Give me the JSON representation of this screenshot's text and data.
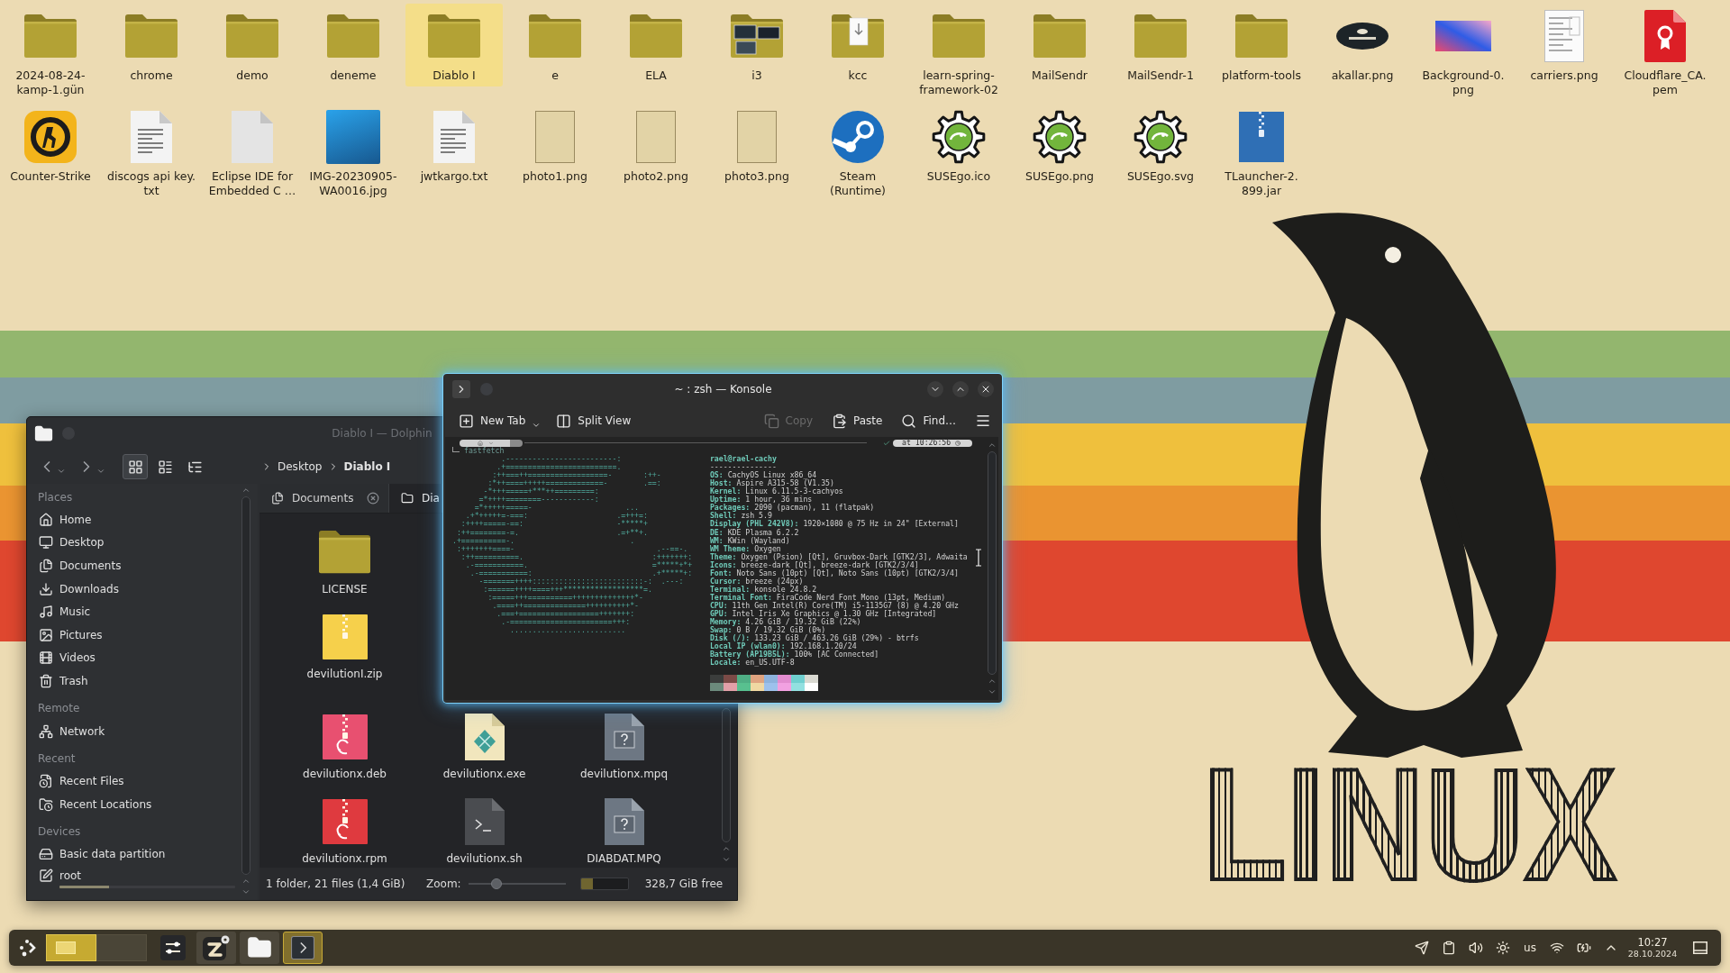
{
  "desktop": {
    "icons": [
      {
        "label": "2024-08-24-kamp-1.gün",
        "kind": "folder",
        "selected": false
      },
      {
        "label": "chrome",
        "kind": "folder",
        "selected": false
      },
      {
        "label": "demo",
        "kind": "folder",
        "selected": false
      },
      {
        "label": "deneme",
        "kind": "folder",
        "selected": false
      },
      {
        "label": "Diablo I",
        "kind": "folder",
        "selected": true
      },
      {
        "label": "e",
        "kind": "folder",
        "selected": false
      },
      {
        "label": "ELA",
        "kind": "folder",
        "selected": false
      },
      {
        "label": "i3",
        "kind": "gallery",
        "selected": false
      },
      {
        "label": "kcc",
        "kind": "page",
        "selected": false
      },
      {
        "label": "learn-spring-framework-02",
        "kind": "folder",
        "selected": false
      },
      {
        "label": "MailSendr",
        "kind": "folder",
        "selected": false
      },
      {
        "label": "MailSendr-1",
        "kind": "folder",
        "selected": false
      },
      {
        "label": "platform-tools",
        "kind": "folder",
        "selected": false
      },
      {
        "label": "akallar.png",
        "kind": "badge",
        "selected": false
      },
      {
        "label": "Background-0.png",
        "kind": "gradient",
        "selected": false
      },
      {
        "label": "carriers.png",
        "kind": "sheet",
        "selected": false
      },
      {
        "label": "Cloudflare_CA.pem",
        "kind": "certificate",
        "selected": false
      },
      {
        "label": "Counter-Strike",
        "kind": "game",
        "selected": false
      },
      {
        "label": "discogs api key.txt",
        "kind": "text",
        "selected": false
      },
      {
        "label": "Eclipse IDE for Embedded C …",
        "kind": "blank",
        "selected": false
      },
      {
        "label": "IMG-20230905-WA0016.jpg",
        "kind": "photo",
        "selected": false
      },
      {
        "label": "jwtkargo.txt",
        "kind": "text",
        "selected": false
      },
      {
        "label": "photo1.png",
        "kind": "poster",
        "selected": false
      },
      {
        "label": "photo2.png",
        "kind": "poster",
        "selected": false
      },
      {
        "label": "photo3.png",
        "kind": "poster",
        "selected": false
      },
      {
        "label": "Steam (Runtime)",
        "kind": "steam",
        "selected": false
      },
      {
        "label": "SUSEgo.ico",
        "kind": "gear",
        "selected": false
      },
      {
        "label": "SUSEgo.png",
        "kind": "gear",
        "selected": false
      },
      {
        "label": "SUSEgo.svg",
        "kind": "gear",
        "selected": false
      },
      {
        "label": "TLauncher-2.899.jar",
        "kind": "archive",
        "selected": false
      }
    ]
  },
  "wallpaper": {
    "text": "LINUX"
  },
  "dolphin": {
    "title": "Diablo I — Dolphin",
    "view_modes": [
      {
        "kind": "icons",
        "selected": true
      },
      {
        "kind": "compact",
        "selected": false
      },
      {
        "kind": "details",
        "selected": false
      }
    ],
    "breadcrumb": [
      {
        "label": "Desktop",
        "current": false
      },
      {
        "label": "Diablo I",
        "current": true
      }
    ],
    "sidebar": [
      {
        "title": "Places",
        "items": [
          {
            "label": "Home",
            "kind": "home",
            "selected": false
          },
          {
            "label": "Desktop",
            "kind": "desktop",
            "selected": false
          },
          {
            "label": "Documents",
            "kind": "documents",
            "selected": false
          },
          {
            "label": "Downloads",
            "kind": "downloads",
            "selected": false
          },
          {
            "label": "Music",
            "kind": "music",
            "selected": false
          },
          {
            "label": "Pictures",
            "kind": "pictures",
            "selected": false
          },
          {
            "label": "Videos",
            "kind": "videos",
            "selected": false
          },
          {
            "label": "Trash",
            "kind": "trash",
            "selected": false
          }
        ]
      },
      {
        "title": "Remote",
        "items": [
          {
            "label": "Network",
            "kind": "network",
            "selected": false
          }
        ]
      },
      {
        "title": "Recent",
        "items": [
          {
            "label": "Recent Files",
            "kind": "recent-files",
            "selected": false
          },
          {
            "label": "Recent Locations",
            "kind": "recent-locations",
            "selected": false
          }
        ]
      },
      {
        "title": "Devices",
        "items": [
          {
            "label": "Basic data partition",
            "kind": "drive",
            "selected": false
          },
          {
            "label": "root",
            "kind": "root",
            "selected": false,
            "level": 0.28
          }
        ]
      }
    ],
    "tabs": [
      {
        "label": "Documents",
        "kind": "documents",
        "selected": false,
        "close_button": true
      },
      {
        "label": "Dia",
        "kind": "folder",
        "selected": true
      }
    ],
    "file_rows": [
      [
        {
          "name": "LICENSE",
          "kind": "folder"
        }
      ],
      [
        {
          "name": "devilutionI.zip",
          "kind": "zip"
        }
      ],
      [
        {
          "name": "devilutionx.deb",
          "kind": "deb"
        },
        {
          "name": "devilutionx.exe",
          "kind": "exe"
        },
        {
          "name": "devilutionx.mpq",
          "kind": "unknown"
        }
      ],
      [
        {
          "name": "devilutionx.rpm",
          "kind": "rpm"
        },
        {
          "name": "devilutionx.sh",
          "kind": "script"
        },
        {
          "name": "DIABDAT.MPQ",
          "kind": "unknown"
        }
      ]
    ],
    "status": {
      "summary": "1 folder, 21 files (1,4 GiB)",
      "zoom_label": "Zoom:",
      "zoom": {
        "level": 0.29
      },
      "disk": {
        "level": 0.25
      },
      "free": "328,7 GiB free"
    }
  },
  "konsole": {
    "title": "~ : zsh — Konsole",
    "toolbar_start": [
      {
        "label": "New Tab",
        "kind": "new-tab",
        "menu": true,
        "disabled": false
      },
      {
        "label": "Split View",
        "kind": "split",
        "disabled": false
      }
    ],
    "toolbar_end": [
      {
        "label": "Copy",
        "kind": "copy",
        "disabled": true
      },
      {
        "label": "Paste",
        "kind": "paste",
        "disabled": false
      },
      {
        "label": "Find…",
        "kind": "find",
        "disabled": false
      }
    ],
    "terminal": {
      "prompt_time": "at 10:26:56",
      "command": "fastfetch",
      "logo": [
        "           .-------------------------:",
        "          .+=========================.",
        "         :++===++==================-       :++-",
        "        :*++====+++++=============-        .==:",
        "       -*+++=====+***++=========:",
        "      =*++++========------------:",
        "     =*+++++=====-                     ...",
        "   .+*+++++=-===:                    .=+++=:",
        "  :++++=====-==:                     -*****+",
        " :++========-=.                      .=+**+.",
        ".+==========-.                          .",
        " :+++++++====-                                .--==-.",
        "  :++==========.                             :+++++++:",
        "   .-===========.                            =*****+*+",
        "    .-===========:                           .+*****+:",
        "      -=======++++:::::::::::::::::::::::::-:  .---:",
        "       :======++++====+++******************=.",
        "        :=====+++==========++++++++++++++*-",
        "         .====++==============++++++++++*-",
        "          .===+==================+++++++:",
        "           .-=======================+++:",
        "             .........................."
      ],
      "user_host": "rael@rael-cachy",
      "separator": "---------------",
      "info": [
        {
          "key": "OS:",
          "value": "CachyOS Linux x86_64"
        },
        {
          "key": "Host:",
          "value": "Aspire A315-58 (V1.35)"
        },
        {
          "key": "Kernel:",
          "value": "Linux 6.11.5-3-cachyos"
        },
        {
          "key": "Uptime:",
          "value": "1 hour, 36 mins"
        },
        {
          "key": "Packages:",
          "value": "2090 (pacman), 11 (flatpak)"
        },
        {
          "key": "Shell:",
          "value": "zsh 5.9"
        },
        {
          "key": "Display (PHL 242V8):",
          "value": "1920×1080 @ 75 Hz in 24\" [External]"
        },
        {
          "key": "DE:",
          "value": "KDE Plasma 6.2.2"
        },
        {
          "key": "WM:",
          "value": "KWin (Wayland)"
        },
        {
          "key": "WM Theme:",
          "value": "Oxygen"
        },
        {
          "key": "Theme:",
          "value": "Oxygen (Psion) [Qt], Gruvbox-Dark [GTK2/3], Adwaita"
        },
        {
          "key": "Icons:",
          "value": "breeze-dark [Qt], breeze-dark [GTK2/3/4]"
        },
        {
          "key": "Font:",
          "value": "Noto Sans (10pt) [Qt], Noto Sans (10pt) [GTK2/3/4]"
        },
        {
          "key": "Cursor:",
          "value": "breeze (24px)"
        },
        {
          "key": "Terminal:",
          "value": "konsole 24.8.2"
        },
        {
          "key": "Terminal Font:",
          "value": "FiraCode Nerd Font Mono (13pt, Medium)"
        },
        {
          "key": "CPU:",
          "value": "11th Gen Intel(R) Core(TM) i5-1135G7 (8) @ 4.20 GHz"
        },
        {
          "key": "GPU:",
          "value": "Intel Iris Xe Graphics @ 1.30 GHz [Integrated]"
        },
        {
          "key": "Memory:",
          "value": "4.26 GiB / 19.32 GiB (22%)"
        },
        {
          "key": "Swap:",
          "value": "0 B / 19.32 GiB (0%)"
        },
        {
          "key": "Disk (/):",
          "value": "133.23 GiB / 463.26 GiB (29%) - btrfs"
        },
        {
          "key": "Local IP (wlan0):",
          "value": "192.168.1.20/24"
        },
        {
          "key": "Battery (AP19B5L):",
          "value": "100% [AC Connected]"
        },
        {
          "key": "Locale:",
          "value": "en_US.UTF-8"
        }
      ],
      "palette": [
        [
          {
            "color": "#3b3d3c"
          },
          {
            "color": "#7b4a46"
          },
          {
            "color": "#4fae84"
          },
          {
            "color": "#dfa37f"
          },
          {
            "color": "#8db2dc"
          },
          {
            "color": "#e28ccf"
          },
          {
            "color": "#6fcfcf"
          },
          {
            "color": "#d9d9d1"
          }
        ],
        [
          {
            "color": "#6c8a7c"
          },
          {
            "color": "#e2a0a8"
          },
          {
            "color": "#58c08f"
          },
          {
            "color": "#f0d8a2"
          },
          {
            "color": "#9dc1ec"
          },
          {
            "color": "#f2a1e1"
          },
          {
            "color": "#92e0e0"
          },
          {
            "color": "#ffffff"
          }
        ]
      ]
    }
  },
  "taskbar": {
    "pager": [
      {
        "selected": true
      },
      {
        "selected": false
      }
    ],
    "tasks": [
      {
        "kind": "settings",
        "running": false,
        "selected": false
      },
      {
        "kind": "chat",
        "running": true,
        "selected": false
      },
      {
        "kind": "files",
        "running": true,
        "selected": false
      },
      {
        "kind": "terminal",
        "running": true,
        "selected": true
      }
    ],
    "tray": [
      {
        "kind": "send"
      },
      {
        "kind": "clipboard"
      },
      {
        "kind": "volume"
      },
      {
        "kind": "brightness"
      },
      {
        "kind": "keyboard",
        "label": "us"
      },
      {
        "kind": "wifi"
      },
      {
        "kind": "battery"
      },
      {
        "kind": "expand"
      }
    ],
    "clock": {
      "time": "10:27",
      "date": "28.10.2024"
    }
  }
}
